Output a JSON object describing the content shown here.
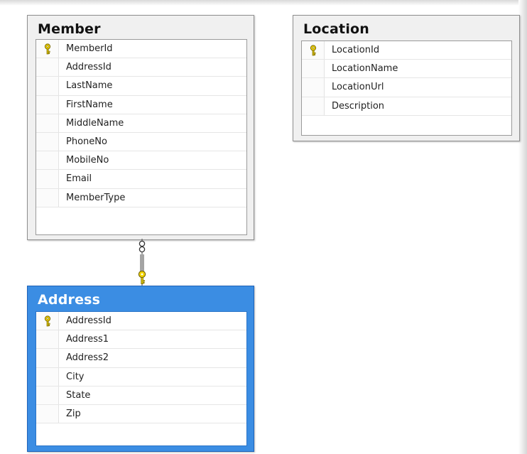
{
  "diagram": {
    "tables": {
      "member": {
        "name": "Member",
        "columns": [
          {
            "name": "MemberId",
            "primary_key": true
          },
          {
            "name": "AddressId",
            "primary_key": false
          },
          {
            "name": "LastName",
            "primary_key": false
          },
          {
            "name": "FirstName",
            "primary_key": false
          },
          {
            "name": "MiddleName",
            "primary_key": false
          },
          {
            "name": "PhoneNo",
            "primary_key": false
          },
          {
            "name": "MobileNo",
            "primary_key": false
          },
          {
            "name": "Email",
            "primary_key": false
          },
          {
            "name": "MemberType",
            "primary_key": false
          }
        ]
      },
      "location": {
        "name": "Location",
        "columns": [
          {
            "name": "LocationId",
            "primary_key": true
          },
          {
            "name": "LocationName",
            "primary_key": false
          },
          {
            "name": "LocationUrl",
            "primary_key": false
          },
          {
            "name": "Description",
            "primary_key": false
          }
        ]
      },
      "address": {
        "name": "Address",
        "selected": true,
        "columns": [
          {
            "name": "AddressId",
            "primary_key": true
          },
          {
            "name": "Address1",
            "primary_key": false
          },
          {
            "name": "Address2",
            "primary_key": false
          },
          {
            "name": "City",
            "primary_key": false
          },
          {
            "name": "State",
            "primary_key": false
          },
          {
            "name": "Zip",
            "primary_key": false
          }
        ]
      }
    },
    "relationships": [
      {
        "from": "Member",
        "to": "Address",
        "from_end": "many",
        "to_end": "key"
      }
    ]
  },
  "colors": {
    "selected_table": "#3b8de3",
    "key_icon": "#e8c800"
  }
}
